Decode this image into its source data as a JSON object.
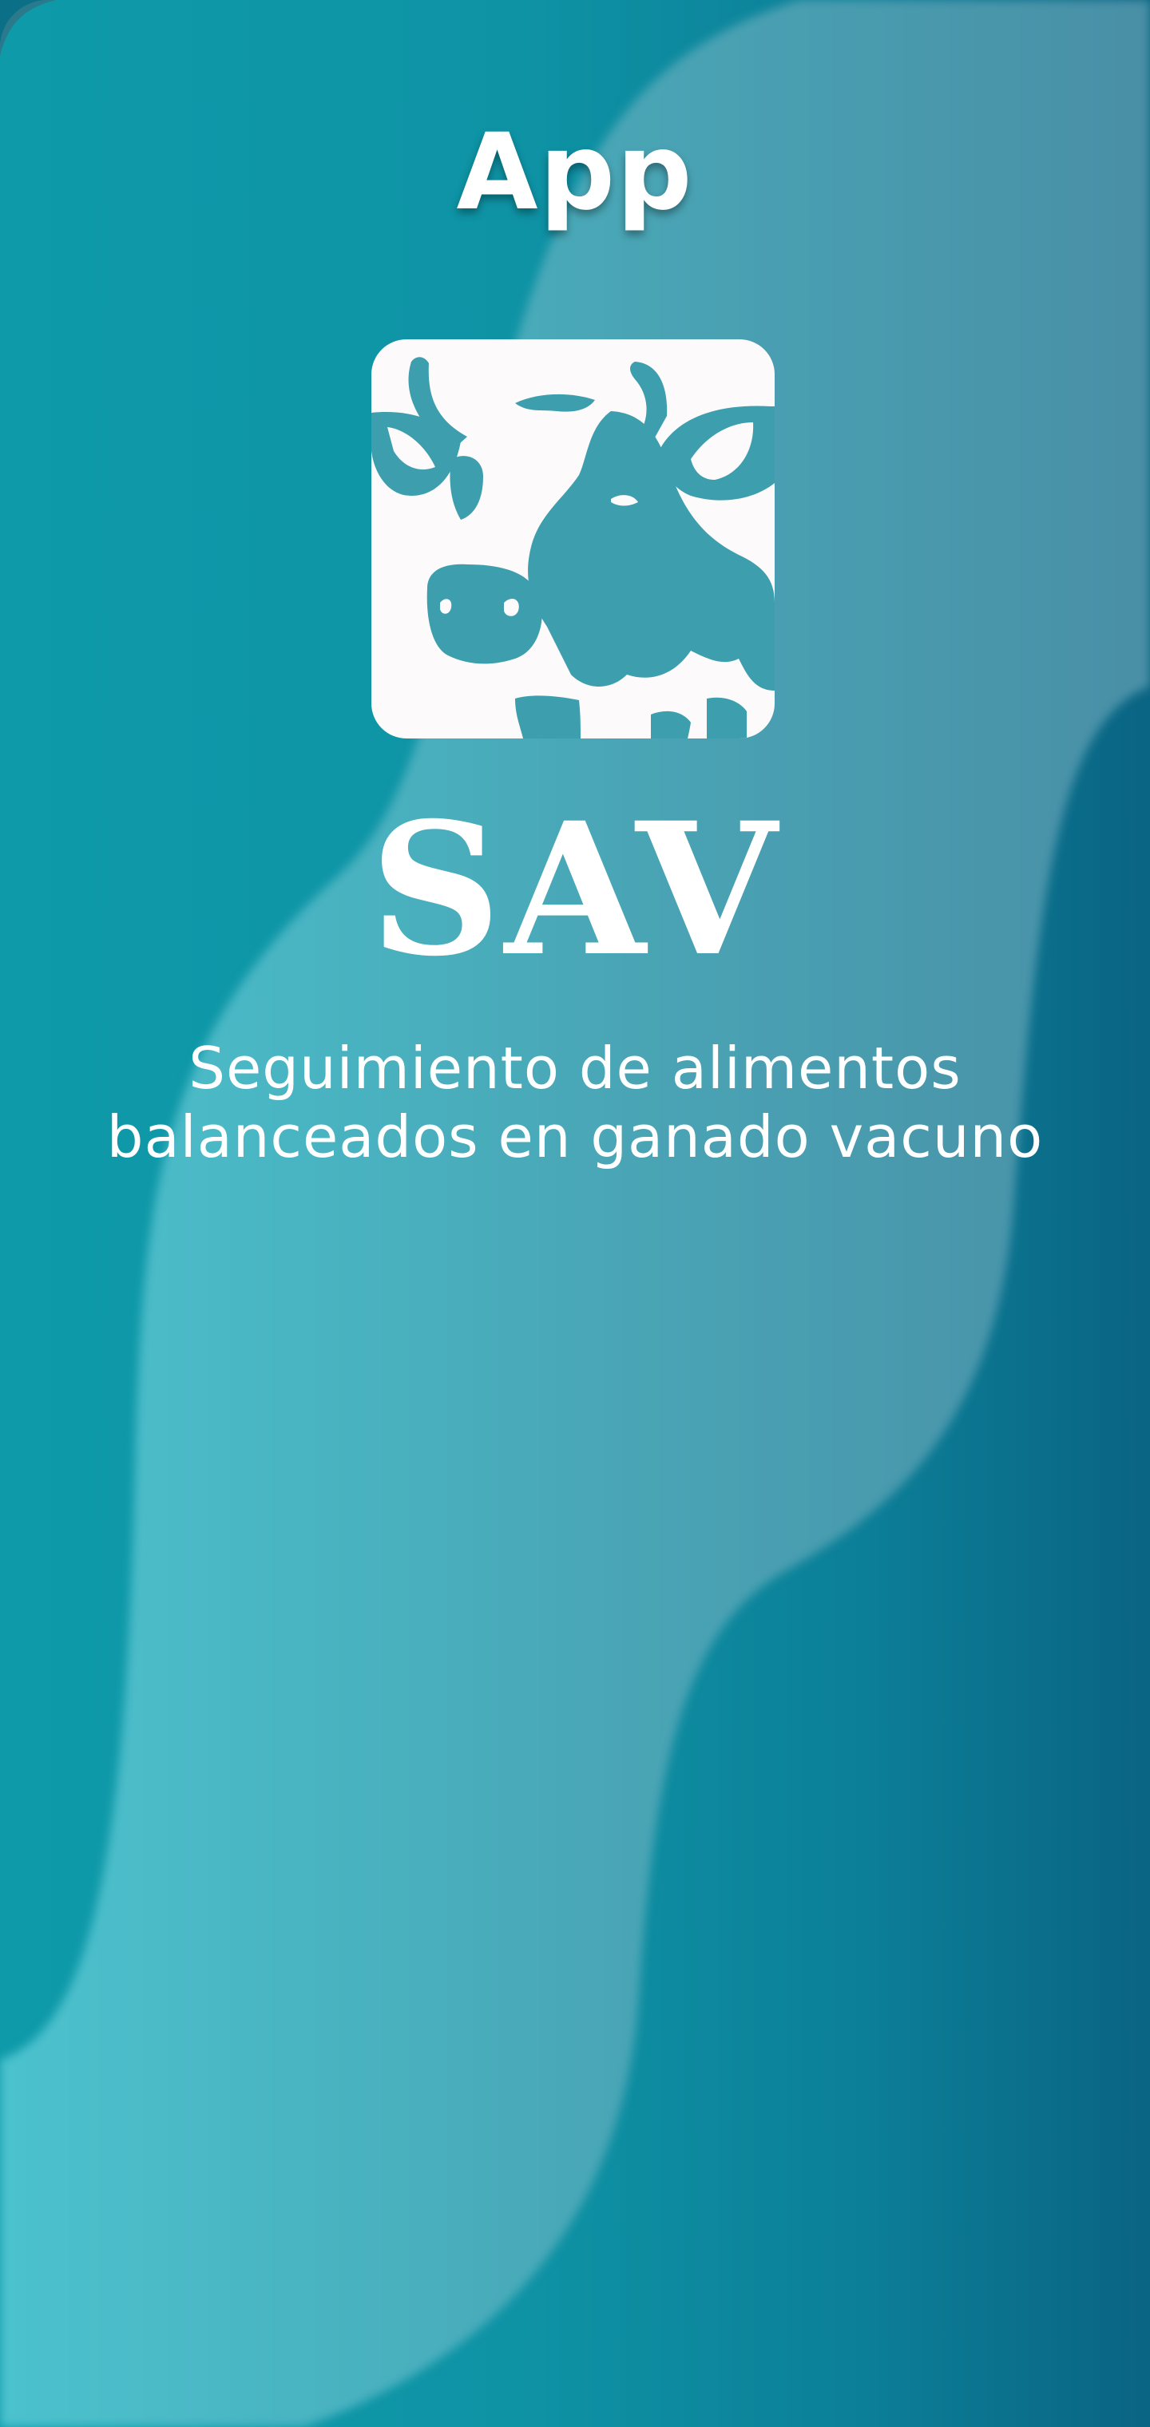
{
  "header": {
    "title": "App"
  },
  "logo": {
    "icon": "cow-head-icon",
    "tile_color": "#fcfafb",
    "figure_color": "#3d9fad"
  },
  "brand": {
    "name": "SAV"
  },
  "tagline": {
    "line1": "Seguimiento de alimentos",
    "line2": "balanceados en ganado vacuno"
  },
  "theme": {
    "background_gradient": [
      "#0e9aa9",
      "#0a6483"
    ],
    "wave_light": "#4bc0cc",
    "text_color": "#ffffff"
  }
}
